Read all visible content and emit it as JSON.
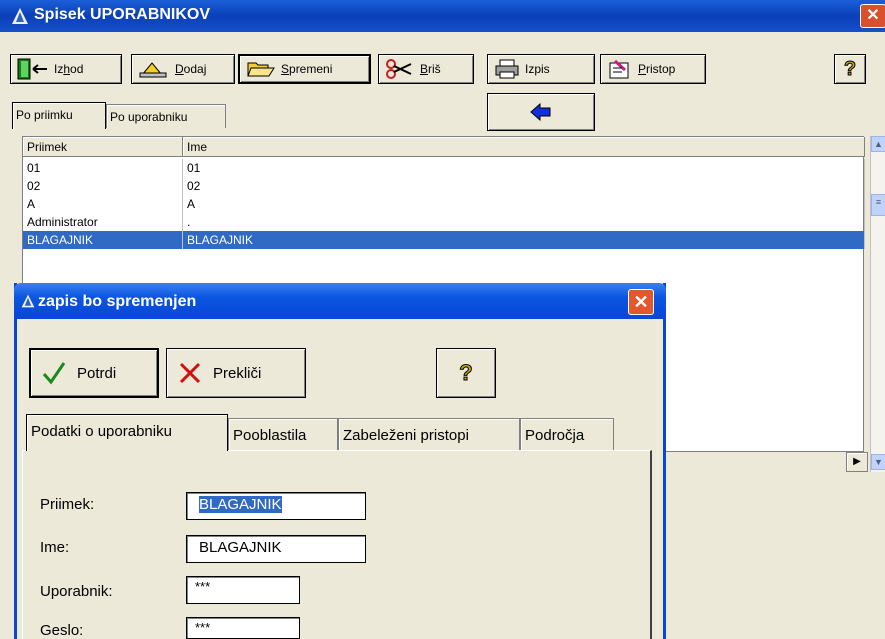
{
  "window": {
    "title": "Spisek UPORABNIKOV",
    "close": "✕"
  },
  "toolbar": {
    "exit": {
      "pre": "Iz",
      "u": "h",
      "post": "od"
    },
    "add": {
      "u": "D",
      "post": "odaj"
    },
    "change": {
      "u": "S",
      "post": "premeni"
    },
    "delete": {
      "u": "B",
      "post": "riš"
    },
    "print": {
      "label": "Izpis"
    },
    "access": {
      "u": "P",
      "post": "ristop"
    },
    "help": "?"
  },
  "tabs": [
    "Po priimku",
    "Po uporabniku"
  ],
  "grid": {
    "columns": [
      "Priimek",
      "Ime"
    ],
    "rows": [
      [
        "01",
        "01"
      ],
      [
        "02",
        "02"
      ],
      [
        "A",
        "A"
      ],
      [
        "Administrator",
        "."
      ],
      [
        "BLAGAJNIK",
        "BLAGAJNIK"
      ]
    ],
    "selected_row": 4
  },
  "dialog": {
    "title": "zapis bo spremenjen",
    "close": "✕",
    "confirm": "Potrdi",
    "cancel": "Prekliči",
    "help": "?",
    "tabs": [
      "Podatki o uporabniku",
      "Pooblastila",
      "Zabeleženi pristopi",
      "Področja"
    ],
    "fields": {
      "surname_label": "Priimek:",
      "surname_value": "BLAGAJNIK",
      "name_label": "Ime:",
      "name_value": "BLAGAJNIK",
      "user_label": "Uporabnik:",
      "user_value": "***",
      "password_label": "Geslo:",
      "password_value": "***"
    }
  },
  "colors": {
    "titlebar": "#0a3fb8",
    "selection": "#316ac5",
    "window_bg": "#ece9d8"
  }
}
